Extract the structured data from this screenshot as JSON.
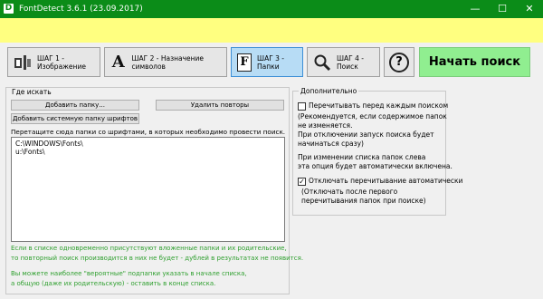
{
  "window": {
    "app_icon_letter": "D",
    "title": "FontDetect 3.6.1 (23.09.2017)",
    "minimize_glyph": "—",
    "maximize_glyph": "☐",
    "close_glyph": "✕"
  },
  "toolbar": {
    "step1_label": "ШАГ 1 - Изображение",
    "step2_label": "ШАГ 2 - Назначение символов",
    "step2_icon_letter": "A",
    "step3_label": "ШАГ 3 - Папки",
    "step3_icon_letter": "F",
    "step4_label": "ШАГ 4 - Поиск",
    "help_glyph": "?",
    "start_label": "Начать поиск"
  },
  "where": {
    "title": "Где искать",
    "add_folder": "Добавить папку...",
    "remove_duplicates": "Удалить повторы",
    "add_system_folder": "Добавить системную папку шрифтов",
    "drag_instruction": "Перетащите сюда папки со шрифтами, в которых необходимо провести поиск.",
    "folders": [
      "C:\\WINDOWS\\Fonts\\",
      "u:\\Fonts\\"
    ],
    "hint1_line1": "Если в списке одновременно присутствуют вложенные папки и их родительские,",
    "hint1_line2": "то повторный поиск производится в них не будет - дублей в результатах не появится.",
    "hint2_line1": "Вы можете наиболее \"вероятные\" подпапки указать в начале списка,",
    "hint2_line2": "а общую (даже их родительскую) - оставить в конце списка."
  },
  "extra": {
    "title": "Дополнительно",
    "recount_label": "Перечитывать перед каждым поиском",
    "recount_checked": false,
    "recount_note1": "(Рекомендуется, если содержимое папок",
    "recount_note2": "не изменяется.",
    "recount_note3": "При отключении запуск поиска будет",
    "recount_note4": "начинаться сразу)",
    "change_note1": "При изменении списка папок слева",
    "change_note2": "эта опция будет автоматически включена.",
    "auto_off_label": "Отключать перечитывание автоматически",
    "auto_off_checked": true,
    "check_glyph": "✓",
    "auto_off_note1": "(Отключать после первого",
    "auto_off_note2": "перечитывания папок при поиске)"
  },
  "colors": {
    "titlebar": "#0b8c18",
    "yellow_band": "#ffff80",
    "active_step": "#b7dcf5",
    "start_button": "#90ee90",
    "hint_text": "#2e9f2e"
  }
}
